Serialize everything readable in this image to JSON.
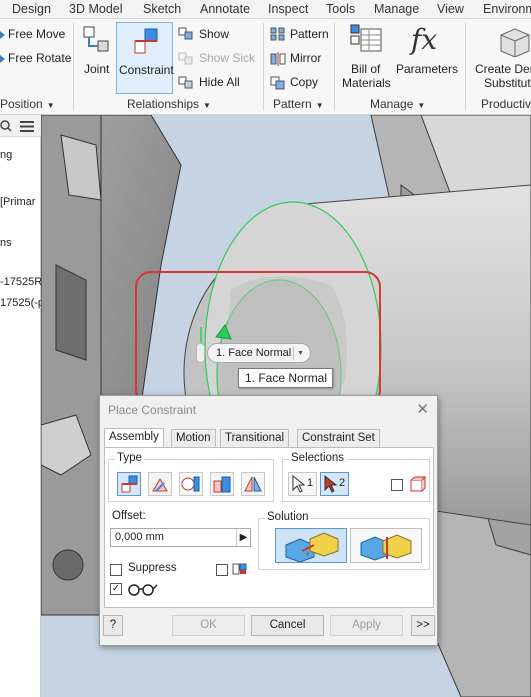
{
  "menu": [
    "Design",
    "3D Model",
    "Sketch",
    "Annotate",
    "Inspect",
    "Tools",
    "Manage",
    "View",
    "Environm"
  ],
  "ribbon": {
    "position": {
      "free_move": "Free Move",
      "free_rotate": "Free Rotate",
      "label": "Position"
    },
    "relationships": {
      "joint": "Joint",
      "constraint": "Constraint",
      "show": "Show",
      "show_sick": "Show Sick",
      "hide_all": "Hide All",
      "label": "Relationships"
    },
    "pattern": {
      "pattern": "Pattern",
      "mirror": "Mirror",
      "copy": "Copy",
      "label": "Pattern"
    },
    "manage": {
      "bom_line1": "Bill of",
      "bom_line2": "Materials",
      "parameters": "Parameters",
      "fx": "fx",
      "label": "Manage"
    },
    "productivity": {
      "create_line1": "Create Der",
      "create_line2": "Substitut",
      "label": "Productiv"
    }
  },
  "browser": {
    "nodes": [
      "ng",
      "[Primar",
      "ns",
      "-17525R",
      "17525(-p"
    ]
  },
  "viewport": {
    "face_pill": "1. Face Normal",
    "tooltip": "1. Face Normal"
  },
  "dialog": {
    "title": "Place Constraint",
    "tabs": [
      "Assembly",
      "Motion",
      "Transitional",
      "Constraint Set"
    ],
    "type_label": "Type",
    "selections_label": "Selections",
    "sel1": "1",
    "sel2": "2",
    "offset_label": "Offset:",
    "offset_value": "0,000 mm",
    "solution_label": "Solution",
    "suppress_label": "Suppress",
    "buttons": {
      "ok": "OK",
      "cancel": "Cancel",
      "apply": "Apply",
      "more": ">>",
      "help": "?"
    }
  },
  "colors": {
    "accent": "#5d97cf",
    "highlight": "#d53636",
    "edge": "#2ecc5a"
  }
}
